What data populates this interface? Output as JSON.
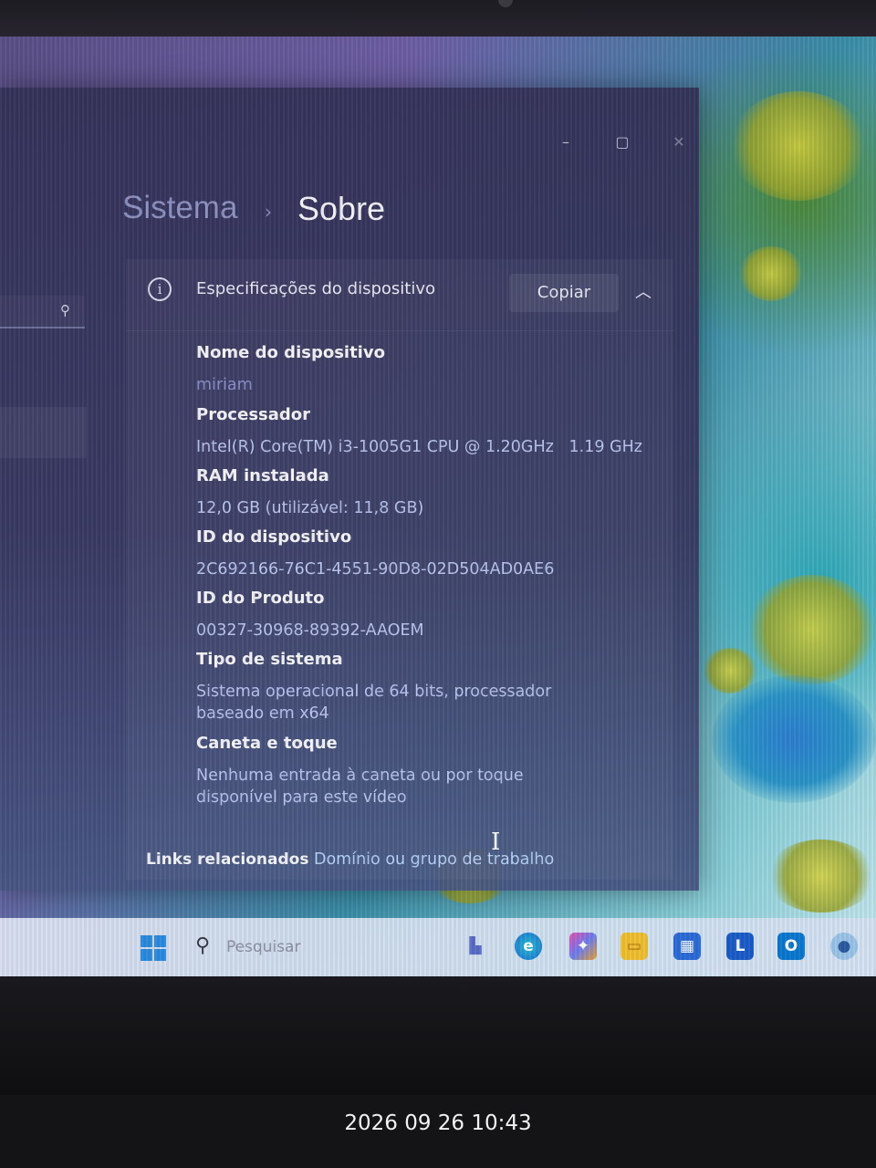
{
  "window": {
    "controls": {
      "minimize": "–",
      "maximize": "▢",
      "close": "✕"
    },
    "nav_search_icon": "search-icon"
  },
  "breadcrumb": {
    "parent": "Sistema",
    "separator": "›",
    "current": "Sobre"
  },
  "device_specs": {
    "header_title": "Especificações do dispositivo",
    "copy_label": "Copiar",
    "collapse_icon": "chevron-up-icon",
    "items": [
      {
        "label": "Nome do dispositivo",
        "value": "miriam"
      },
      {
        "label": "Processador",
        "value": "Intel(R) Core(TM) i3-1005G1 CPU @ 1.20GHz   1.19 GHz"
      },
      {
        "label": "RAM instalada",
        "value": "12,0 GB (utilizável: 11,8 GB)"
      },
      {
        "label": "ID do dispositivo",
        "value": "2C692166-76C1-4551-90D8-02D504AD0AE6"
      },
      {
        "label": "ID do Produto",
        "value": "00327-30968-89392-AAOEM"
      },
      {
        "label": "Tipo de sistema",
        "value": "Sistema operacional de 64 bits, processador baseado em x64"
      },
      {
        "label": "Caneta e toque",
        "value": "Nenhuma entrada à caneta ou por toque disponível para este vídeo"
      }
    ]
  },
  "related": {
    "label": "Links relacionados",
    "link": "Domínio ou grupo de trabalho"
  },
  "taskbar": {
    "search_placeholder": "Pesquisar",
    "icons": [
      "windows-start-icon",
      "search-icon",
      "task-view-icon",
      "edge-icon",
      "copilot-icon",
      "file-explorer-icon",
      "store-icon",
      "app-l-icon",
      "outlook-icon",
      "user-icon"
    ]
  },
  "photo_timestamp": "2026 09 26 10:43"
}
